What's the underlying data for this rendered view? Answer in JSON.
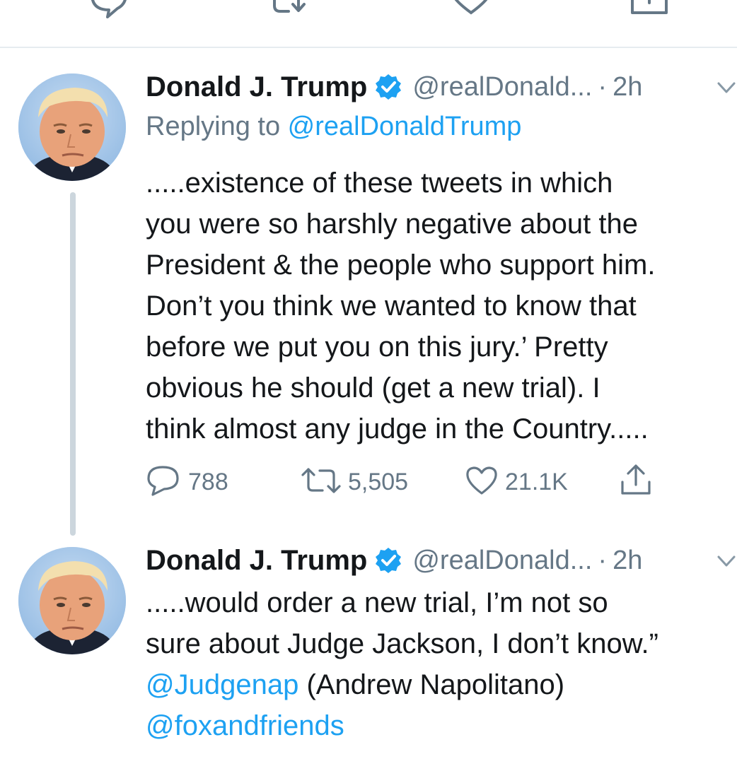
{
  "top_actions": [
    "reply-icon",
    "retweet-icon",
    "like-icon",
    "share-icon"
  ],
  "colors": {
    "link": "#1da1f2",
    "secondary_text": "#657786",
    "thread_line": "#ccd6dd",
    "divider": "#e6ecf0"
  },
  "tweets": [
    {
      "display_name": "Donald J. Trump",
      "handle": "@realDonald...",
      "dot": "·",
      "time": "2h",
      "reply_prefix": "Replying to ",
      "reply_mention": "@realDonaldTrump",
      "lines": [
        ".....existence of these tweets in which",
        "you were so harshly negative about the",
        "President & the people who support him.",
        "Don’t you think we wanted to know that",
        "before we put you on this jury.’ Pretty",
        "obvious he should (get a new trial). I",
        "think almost any judge in the Country....."
      ],
      "actions": {
        "replies": "788",
        "retweets": "5,505",
        "likes": "21.1K"
      }
    },
    {
      "display_name": "Donald J. Trump",
      "handle": "@realDonald...",
      "dot": "·",
      "time": "2h",
      "lines": [
        ".....would order a new trial, I’m not so",
        "sure about Judge Jackson, I don’t know.”"
      ],
      "mention_1": "@Judgenap",
      "mention_1_suffix": " (Andrew Napolitano)",
      "mention_2": "@foxandfriends"
    }
  ]
}
